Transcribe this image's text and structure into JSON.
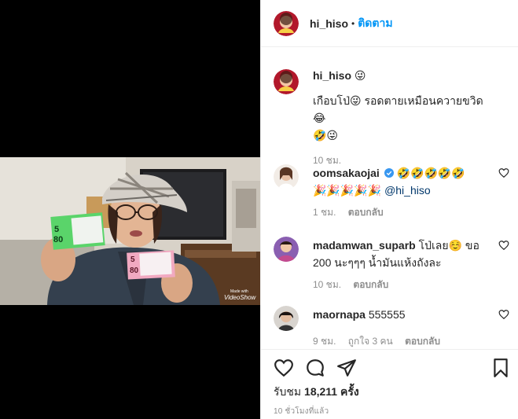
{
  "post": {
    "username": "hi_hiso",
    "follow_separator": "•",
    "follow_label": "ติดตาม",
    "caption_user": "hi_hiso 😜",
    "caption_line1": "เกือบโป่😜 รอดตายเหมือนควายขวิด😂",
    "caption_line2": "🤣😜",
    "caption_time": "10 ชม."
  },
  "video": {
    "watermark_small": "Made with",
    "watermark_brand": "VideoShow",
    "ticket_green_top": "5",
    "ticket_green_bottom": "80",
    "ticket_pink_top": "5",
    "ticket_pink_bottom": "80"
  },
  "comments": [
    {
      "username": "oomsakaojai",
      "verified": true,
      "text_line1": "🤣🤣🤣🤣🤣",
      "text_line2": "🎉🎉🎉🎉🎉",
      "mention": "@hi_hiso",
      "time": "1 ชม.",
      "likes": "",
      "reply": "ตอบกลับ"
    },
    {
      "username": "madamwan_suparb",
      "text_line1": " โป่เลย☺️ ขอ",
      "text_line2": "200 นะๆๆๆ น้ำมันแห้งถังละ",
      "time": "10 ชม.",
      "likes": "",
      "reply": "ตอบกลับ"
    },
    {
      "username": "maornapa",
      "text_line1": " 555555",
      "text_line2": "",
      "time": "9 ชม.",
      "likes": "ถูกใจ 3 คน",
      "reply": "ตอบกลับ"
    }
  ],
  "footer": {
    "views_label": "รับชม",
    "views_count": "18,211",
    "views_unit": "ครั้ง",
    "timestamp": "10 ชั่วโมงที่แล้ว"
  },
  "icons": {
    "like": "heart-outline-icon",
    "comment": "comment-bubble-icon",
    "share": "paper-plane-icon",
    "save": "bookmark-icon"
  },
  "colors": {
    "follow": "#0095f6",
    "text": "#262626",
    "muted": "#8e8e8e",
    "verified": "#3897f0"
  }
}
